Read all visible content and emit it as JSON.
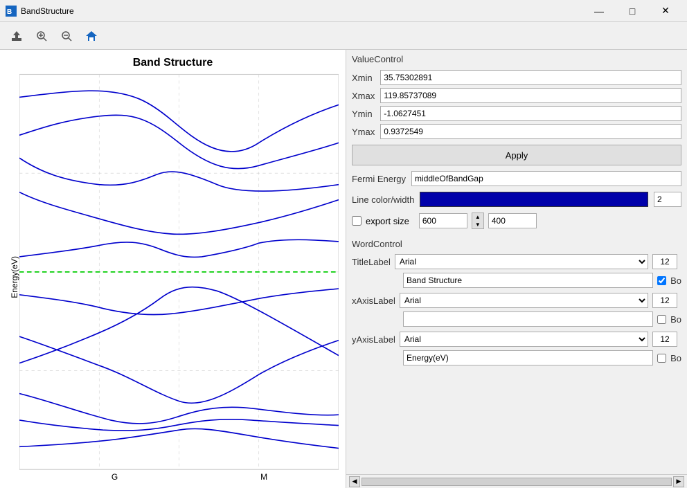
{
  "window": {
    "title": "BandStructure",
    "min_btn": "—",
    "max_btn": "□",
    "close_btn": "✕"
  },
  "toolbar": {
    "export_icon": "⬆",
    "zoom_in_icon": "🔍",
    "zoom_out_icon": "🔍",
    "home_icon": "🏠"
  },
  "chart": {
    "title": "Band Structure",
    "y_axis_label": "Energy(eV)",
    "x_labels": [
      "G",
      "M"
    ]
  },
  "right_panel": {
    "value_control_label": "ValueControl",
    "xmin_label": "Xmin",
    "xmin_value": "35.75302891",
    "xmax_label": "Xmax",
    "xmax_value": "119.85737089",
    "ymin_label": "Ymin",
    "ymin_value": "-1.0627451",
    "ymax_label": "Ymax",
    "ymax_value": "0.9372549",
    "apply_label": "Apply",
    "fermi_energy_label": "Fermi Energy",
    "fermi_energy_value": "middleOfBandGap",
    "line_color_label": "Line color/width",
    "line_width_value": "2",
    "export_size_label": "export size",
    "export_width": "600",
    "export_height": "400",
    "word_control_label": "WordControl",
    "title_label_label": "TitleLabel",
    "title_font": "Arial",
    "title_size": "12",
    "title_text": "Band Structure",
    "title_bold_label": "Bo",
    "xaxis_label_label": "xAxisLabel",
    "xaxis_font": "Arial",
    "xaxis_size": "12",
    "xaxis_text": "",
    "xaxis_bold_label": "Bo",
    "yaxis_label_label": "yAxisLabel",
    "yaxis_font": "Arial",
    "yaxis_size": "12",
    "yaxis_text": "Energy(eV)",
    "yaxis_bold_label": "Bo"
  }
}
